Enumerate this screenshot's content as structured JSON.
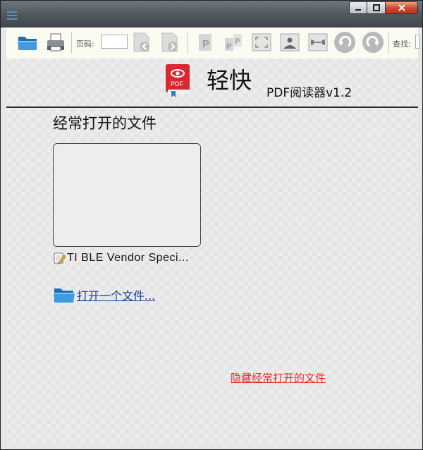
{
  "toolbar": {
    "page_label": "页码:",
    "page_value": "",
    "search_label": "查找:",
    "search_value": ""
  },
  "header": {
    "app_name": "轻快",
    "app_subtitle": "PDF阅读器v1.2",
    "logo_text": "PDF"
  },
  "recent": {
    "title": "经常打开的文件",
    "files": [
      {
        "name": "TI  BLE  Vendor  Speci..."
      }
    ]
  },
  "actions": {
    "open_file": "打开一个文件...",
    "hide_recent": "隐藏经常打开的文件"
  },
  "colors": {
    "toolbar_bg": "#fbfbf1",
    "link_blue": "#1d3a8f",
    "link_red": "#e23030",
    "logo_red": "#d9282f"
  }
}
